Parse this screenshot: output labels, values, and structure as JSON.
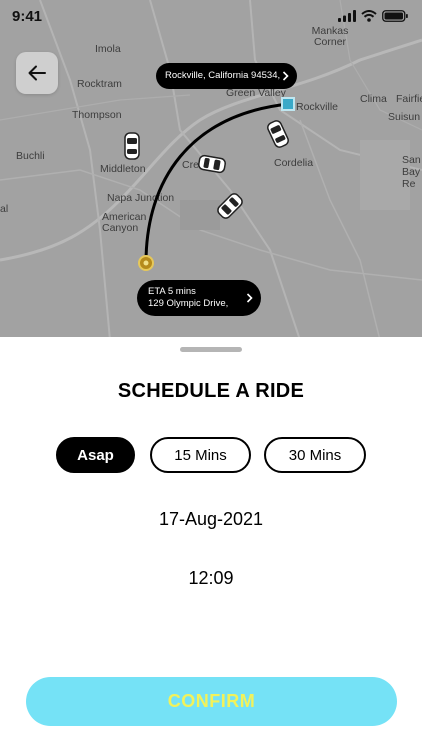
{
  "status_bar": {
    "time": "9:41"
  },
  "map": {
    "labels": {
      "imola": "Imola",
      "rocktram": "Rocktram",
      "thompson": "Thompson",
      "buchli": "Buchli",
      "middleton": "Middleton",
      "napa_junction": "Napa Junction",
      "american_canyon": "American Canyon",
      "cordelia": "Cordelia",
      "rockville": "Rockville",
      "green_valley": "Green Valley",
      "clima": "Clima",
      "fairfield": "Fairfie",
      "suisun": "Suisun",
      "san_bay": "San Bay Re",
      "manios_corner": "Mankas Corner",
      "cre": "Cre",
      "edge_al": "al"
    },
    "destination_pill": "Rockville, California 94534,",
    "eta_pill": {
      "line1": "ETA 5 mins",
      "line2": "129 Olympic Drive,"
    }
  },
  "sheet": {
    "title": "SCHEDULE A RIDE",
    "options": [
      {
        "label": "Asap",
        "selected": true
      },
      {
        "label": "15 Mins",
        "selected": false
      },
      {
        "label": "30 Mins",
        "selected": false
      }
    ],
    "date": "17-Aug-2021",
    "time": "12:09",
    "confirm_label": "CONFIRM"
  },
  "colors": {
    "accent": "#75e2f6",
    "confirm_text": "#f2f25a",
    "route": "#000000",
    "origin_marker": "#b58a1c",
    "destination_marker": "#3aa9c8"
  },
  "icons": [
    "back-arrow-icon",
    "chevron-right-icon",
    "car-icon",
    "signal-icon",
    "wifi-icon",
    "battery-icon"
  ]
}
